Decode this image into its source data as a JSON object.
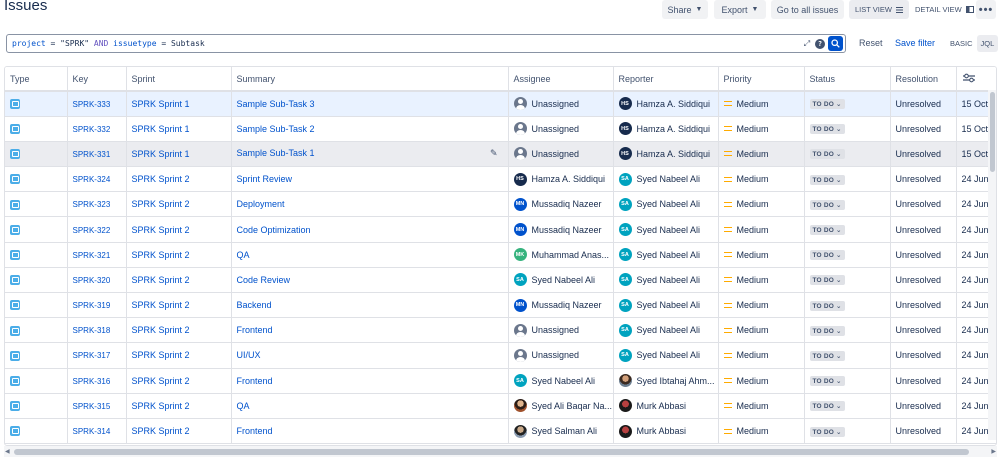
{
  "page": {
    "title": "Issues"
  },
  "header": {
    "share_label": "Share",
    "export_label": "Export",
    "go_all_label": "Go to all issues",
    "list_view_label": "LIST VIEW",
    "detail_view_label": "DETAIL VIEW",
    "more_label": "•••"
  },
  "search": {
    "query_parts": [
      "project",
      " = ",
      "\"SPRK\"",
      " AND ",
      "issuetype",
      " = ",
      "Subtask"
    ],
    "reset_label": "Reset",
    "save_filter_label": "Save filter",
    "basic_label": "BASIC",
    "jql_label": "JQL",
    "help_label": "?"
  },
  "table": {
    "columns": [
      "Type",
      "Key",
      "Sprint",
      "Summary",
      "Assignee",
      "Reporter",
      "Priority",
      "Status",
      "Resolution",
      ""
    ],
    "rows": [
      {
        "key": "SPRK-333",
        "sprint": "SPRK Sprint 1",
        "summary": "Sample Sub-Task 3",
        "assignee": "Unassigned",
        "assignee_av": "un",
        "assignee_init": "",
        "reporter": "Hamza A. Siddiqui",
        "reporter_av": "hs",
        "reporter_init": "HS",
        "priority": "Medium",
        "status": "TO DO",
        "resolution": "Unresolved",
        "created": "15 Oct",
        "state": "sel"
      },
      {
        "key": "SPRK-332",
        "sprint": "SPRK Sprint 1",
        "summary": "Sample Sub-Task 2",
        "assignee": "Unassigned",
        "assignee_av": "un",
        "assignee_init": "",
        "reporter": "Hamza A. Siddiqui",
        "reporter_av": "hs",
        "reporter_init": "HS",
        "priority": "Medium",
        "status": "TO DO",
        "resolution": "Unresolved",
        "created": "15 Oct",
        "state": ""
      },
      {
        "key": "SPRK-331",
        "sprint": "SPRK Sprint 1",
        "summary": "Sample Sub-Task 1",
        "assignee": "Unassigned",
        "assignee_av": "un",
        "assignee_init": "",
        "reporter": "Hamza A. Siddiqui",
        "reporter_av": "hs",
        "reporter_init": "HS",
        "priority": "Medium",
        "status": "TO DO",
        "resolution": "Unresolved",
        "created": "15 Oct",
        "state": "hov"
      },
      {
        "key": "SPRK-324",
        "sprint": "SPRK Sprint 2",
        "summary": "Sprint Review",
        "assignee": "Hamza A. Siddiqui",
        "assignee_av": "hs",
        "assignee_init": "HS",
        "reporter": "Syed Nabeel Ali",
        "reporter_av": "sa",
        "reporter_init": "SA",
        "priority": "Medium",
        "status": "TO DO",
        "resolution": "Unresolved",
        "created": "24 Jun",
        "state": ""
      },
      {
        "key": "SPRK-323",
        "sprint": "SPRK Sprint 2",
        "summary": "Deployment",
        "assignee": "Mussadiq Nazeer",
        "assignee_av": "mn",
        "assignee_init": "MN",
        "reporter": "Syed Nabeel Ali",
        "reporter_av": "sa",
        "reporter_init": "SA",
        "priority": "Medium",
        "status": "TO DO",
        "resolution": "Unresolved",
        "created": "24 Jun",
        "state": ""
      },
      {
        "key": "SPRK-322",
        "sprint": "SPRK Sprint 2",
        "summary": "Code Optimization",
        "assignee": "Mussadiq Nazeer",
        "assignee_av": "mn",
        "assignee_init": "MN",
        "reporter": "Syed Nabeel Ali",
        "reporter_av": "sa",
        "reporter_init": "SA",
        "priority": "Medium",
        "status": "TO DO",
        "resolution": "Unresolved",
        "created": "24 Jun",
        "state": ""
      },
      {
        "key": "SPRK-321",
        "sprint": "SPRK Sprint 2",
        "summary": "QA",
        "assignee": "Muhammad Anas...",
        "assignee_av": "mk",
        "assignee_init": "MK",
        "reporter": "Syed Nabeel Ali",
        "reporter_av": "sa",
        "reporter_init": "SA",
        "priority": "Medium",
        "status": "TO DO",
        "resolution": "Unresolved",
        "created": "24 Jun",
        "state": ""
      },
      {
        "key": "SPRK-320",
        "sprint": "SPRK Sprint 2",
        "summary": "Code Review",
        "assignee": "Syed Nabeel Ali",
        "assignee_av": "sa",
        "assignee_init": "SA",
        "reporter": "Syed Nabeel Ali",
        "reporter_av": "sa",
        "reporter_init": "SA",
        "priority": "Medium",
        "status": "TO DO",
        "resolution": "Unresolved",
        "created": "24 Jun",
        "state": ""
      },
      {
        "key": "SPRK-319",
        "sprint": "SPRK Sprint 2",
        "summary": "Backend",
        "assignee": "Mussadiq Nazeer",
        "assignee_av": "mn",
        "assignee_init": "MN",
        "reporter": "Syed Nabeel Ali",
        "reporter_av": "sa",
        "reporter_init": "SA",
        "priority": "Medium",
        "status": "TO DO",
        "resolution": "Unresolved",
        "created": "24 Jun",
        "state": ""
      },
      {
        "key": "SPRK-318",
        "sprint": "SPRK Sprint 2",
        "summary": "Frontend",
        "assignee": "Unassigned",
        "assignee_av": "un",
        "assignee_init": "",
        "reporter": "Syed Nabeel Ali",
        "reporter_av": "sa",
        "reporter_init": "SA",
        "priority": "Medium",
        "status": "TO DO",
        "resolution": "Unresolved",
        "created": "24 Jun",
        "state": ""
      },
      {
        "key": "SPRK-317",
        "sprint": "SPRK Sprint 2",
        "summary": "UI/UX",
        "assignee": "Unassigned",
        "assignee_av": "un",
        "assignee_init": "",
        "reporter": "Syed Nabeel Ali",
        "reporter_av": "sa",
        "reporter_init": "SA",
        "priority": "Medium",
        "status": "TO DO",
        "resolution": "Unresolved",
        "created": "24 Jun",
        "state": ""
      },
      {
        "key": "SPRK-316",
        "sprint": "SPRK Sprint 2",
        "summary": "Frontend",
        "assignee": "Syed Nabeel Ali",
        "assignee_av": "sa",
        "assignee_init": "SA",
        "reporter": "Syed Ibtahaj Ahm...",
        "reporter_av": "photo1",
        "reporter_init": "",
        "priority": "Medium",
        "status": "TO DO",
        "resolution": "Unresolved",
        "created": "24 Jun",
        "state": ""
      },
      {
        "key": "SPRK-315",
        "sprint": "SPRK Sprint 2",
        "summary": "QA",
        "assignee": "Syed Ali Baqar Na...",
        "assignee_av": "photo2",
        "assignee_init": "",
        "reporter": "Murk Abbasi",
        "reporter_av": "photo3",
        "reporter_init": "",
        "priority": "Medium",
        "status": "TO DO",
        "resolution": "Unresolved",
        "created": "24 Jun",
        "state": ""
      },
      {
        "key": "SPRK-314",
        "sprint": "SPRK Sprint 2",
        "summary": "Frontend",
        "assignee": "Syed Salman Ali",
        "assignee_av": "photo4",
        "assignee_init": "",
        "reporter": "Murk Abbasi",
        "reporter_av": "photo3",
        "reporter_init": "",
        "priority": "Medium",
        "status": "TO DO",
        "resolution": "Unresolved",
        "created": "24 Jun",
        "state": ""
      }
    ]
  },
  "colors": {
    "link": "#0052cc",
    "priority_medium": "#ffab00",
    "selected_row": "#e9f2ff",
    "subtask_icon": "#4bade8"
  },
  "icons": {
    "type": "subtask-icon",
    "priority": "priority-medium-icon",
    "settings": "column-settings-icon",
    "edit": "pencil-icon"
  }
}
